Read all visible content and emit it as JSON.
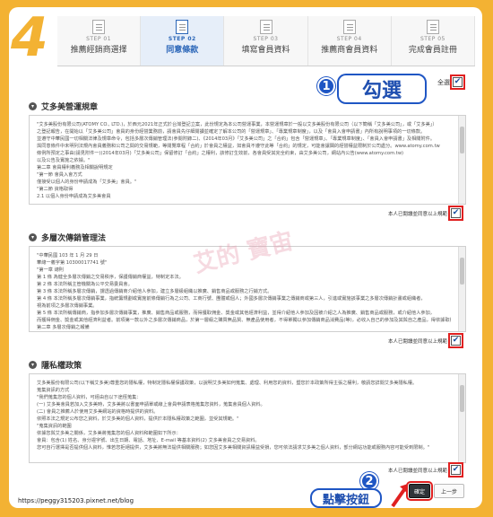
{
  "big_step": "4",
  "steps": [
    {
      "num": "STEP 01",
      "label": "推薦經銷商選擇",
      "active": false
    },
    {
      "num": "STEP 02",
      "label": "同意條款",
      "active": true
    },
    {
      "num": "STEP 03",
      "label": "填寫會員資料",
      "active": false
    },
    {
      "num": "STEP 04",
      "label": "推薦商會員資料",
      "active": false
    },
    {
      "num": "STEP 05",
      "label": "完成會員註冊",
      "active": false
    }
  ],
  "check_all": {
    "label": "全選",
    "checked": true
  },
  "annotations": {
    "badge1": "1",
    "callout1": "勾選",
    "badge2": "2",
    "callout2": "點擊按鈕"
  },
  "sections": [
    {
      "title": "艾多美營運規章",
      "lines": [
        "\"艾多美股份有限公司(ATOMY CO., LTD.)，於西元2021年正式於台灣登記立案，此份規定為本公司營運事業，本營運規章於一般以艾多美股份有限公司（以下簡稱「艾多美公司」，或「艾多美」）",
        "之登記報告，在開始以「艾多美公司」會員的身份經營業務前，請會員先仔細閱讀並確定了解本公司的「營運規章」、「專業規章制度」，以及「會員入會申請書」內所有說明事項的一切條款。",
        "並遵守中華民國一切相關法律及規章命令，包括多層次傳銷管理法(參閱附錄二)、《2014年03月》「艾多美公司」之「合約」包含「營運規章」、「專業規章制度」、「會員入會申請書」及相關附件。",
        "與同意條件中未明列法規內會員義務和公司之間的交易規範，等閱覽章程「合約」於會員之權益，如會員不遵守此等「合約」的規定，可能會讓閣的經營權益限制於公司處分。www.atomy.com.tw",
        "條例所預定之事由(請見附件一)(2014年03月)「艾多美公司」保留修訂「合約」之權利，該修訂生效前，各會員受其完全約束，由艾多美公司，網站內公告(www.atomy.com.tw)",
        "以及公告及實施之依據。\"",
        "第二章 會員權利義務及相關說明規定",
        "\"第一節 會員入會方式",
        "僅接受以個人的身份申請成為「艾多美」會員。\"",
        "\"第二節 資格取得",
        "2.1 以個人身份申請成為艾多美會員"
      ],
      "agree_label": "本人已閱讀並同意以上規範",
      "checked": true
    },
    {
      "title": "多層次傳銷管理法",
      "lines": [
        "\"中華民國 103 年 1 月 29 日",
        "華總一義字第 10300017741 號\"",
        "\"第一章 總則",
        "第 1 條 為健全多層次傳銷之交易秩序，保護傳銷商權益，特制定本法。",
        "第 2 條 本法所稱主管機關為公平交易委員會。",
        "第 3 條 本法所稱多層次傳銷，謂透過傳銷商介紹他人參加，建立多層級組織以推廣、銷售商品或服務之行銷方式。",
        "第 4 條 本法所稱多層次傳銷事業，指統籌規劃或實施前條傳銷行為之公司、工商行號、團體或個人；外國多層次傳銷事業之傳銷商或第三人，引進或實施該事業之多層次傳銷計畫或組織者，",
        "視為前項之多層次傳銷事業。",
        "第 5 條 本法所稱傳銷商，指參加多層次傳銷事業，推廣、銷售商品或服務，而得獲取佣金、獎金或其他經濟利益，並得介紹他人參加及因被介紹之人為推廣、銷售商品或服務，或介紹他人參加，",
        "而獲得佣金、獎金或其他經濟利益者。前項第一款以外之多層次傳銷商品，於第一層級之購買無品質、無產品使用者，不得單獨以參加傳銷商品消費品(等)，必收入自己的參加及其與自之產品，得依據取得之規費。",
        "第二章 多層次傳銷之報備"
      ],
      "agree_label": "本人已閱讀並同意以上規範",
      "checked": true
    },
    {
      "title": "隱私權政策",
      "lines": [
        "艾多美股份有限公司(以下稱艾多美)尊重您的隱私權，特制定隱私權保護政策，以說明艾多美如何蒐集、處理、利用您的資料，暨您於本政策所得主張之權利，敬請您詳閱艾多美隱私權。",
        "",
        "蒐集資訊的方式",
        "\"我們蒐集您的個人資料，可經由自以下途徑蒐集：",
        "(一) 艾多美會員若加入艾多美時，艾多美將以書面申請單或線上會員申請表格蒐集您資料，蒐集會員個人資料。",
        "(二) 會員之推薦人於使用艾多美網站的資格時提供的資料。",
        "依照本法之規定公布您之資料，於艾多美的個人資料，提供於本隱私權政策之範圍，並受其規範。\"",
        "\"蒐集資訊的範圍",
        "依據您與艾多美之關係，艾多美將蒐集您的個人資料和範圍如下所示：",
        "會員：包含(1) 姓名、身分證字號、出生日期、電話、地址、E-mail 等基本資料(2) 艾多美會員之交易資料。",
        "您可自行選擇是否提供個人資料，惟若您拒絕提供，艾多美將無法提供相關服務；如您因艾多美相關資訊權益受損，您可依法請求艾多美之個人資料，部分網站功能或服務內容可能受到限制。\""
      ],
      "agree_label": "本人已閱讀並同意以上規範",
      "checked": true
    }
  ],
  "buttons": {
    "next": "確定",
    "prev": "上一步"
  },
  "watermark": "艾的 寶宙",
  "url": "https://peggy315203.pixnet.net/blog",
  "colors": {
    "accent_orange": "#f3b233",
    "highlight_red": "#e02020",
    "badge_blue": "#1f56c4"
  }
}
